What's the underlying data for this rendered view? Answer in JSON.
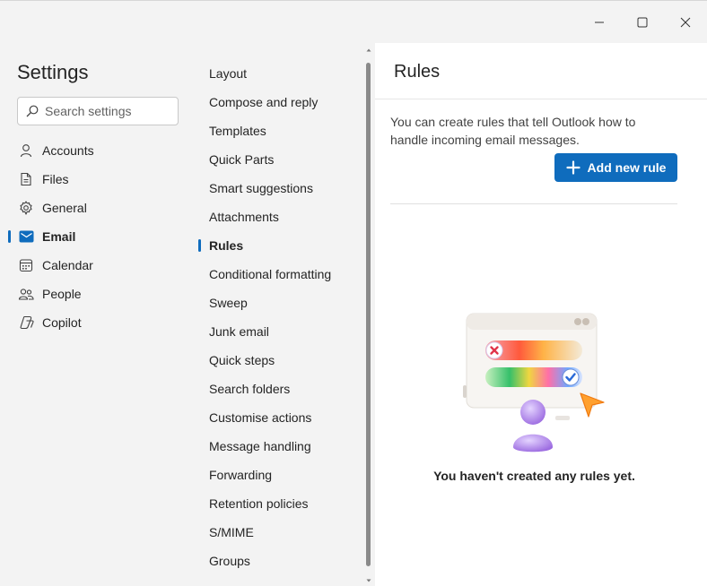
{
  "window": {
    "minimize_icon": "minimize-icon",
    "maximize_icon": "maximize-icon",
    "close_icon": "close-icon"
  },
  "nav": {
    "title": "Settings",
    "search_placeholder": "Search settings",
    "items": [
      {
        "label": "Accounts",
        "icon": "person-icon"
      },
      {
        "label": "Files",
        "icon": "document-icon"
      },
      {
        "label": "General",
        "icon": "gear-icon"
      },
      {
        "label": "Email",
        "icon": "mail-icon",
        "active": true
      },
      {
        "label": "Calendar",
        "icon": "calendar-icon"
      },
      {
        "label": "People",
        "icon": "people-icon"
      },
      {
        "label": "Copilot",
        "icon": "copilot-icon"
      }
    ]
  },
  "email_sections": [
    "Layout",
    "Compose and reply",
    "Templates",
    "Quick Parts",
    "Smart suggestions",
    "Attachments",
    "Rules",
    "Conditional formatting",
    "Sweep",
    "Junk email",
    "Quick steps",
    "Search folders",
    "Customise actions",
    "Message handling",
    "Forwarding",
    "Retention policies",
    "S/MIME",
    "Groups"
  ],
  "active_section": "Rules",
  "main": {
    "title": "Rules",
    "description": "You can create rules that tell Outlook how to handle incoming email messages.",
    "add_button_label": "Add new rule",
    "empty_state_text": "You haven't created any rules yet."
  },
  "colors": {
    "accent": "#0f6cbd",
    "background": "#f3f3f3",
    "panel": "#ffffff"
  }
}
